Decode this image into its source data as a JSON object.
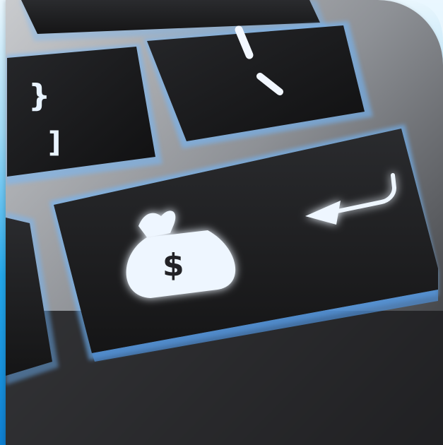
{
  "image": {
    "subject": "keyboard-enter-key-with-money-bag",
    "keys": [
      {
        "id": "bracket-key",
        "symbols": [
          "}",
          "]"
        ]
      },
      {
        "id": "quote-key",
        "symbols": [
          "\"",
          "'"
        ]
      },
      {
        "id": "enter-key",
        "symbols": [
          "$",
          "↵"
        ]
      }
    ],
    "colors": {
      "key": "#1c1c1e",
      "key_top": "#26272a",
      "chassis": "#8d9094",
      "glow": "#cfe8ff",
      "edge_glow": "#6fb8ff",
      "frame_blue": "#1a9be6"
    }
  }
}
